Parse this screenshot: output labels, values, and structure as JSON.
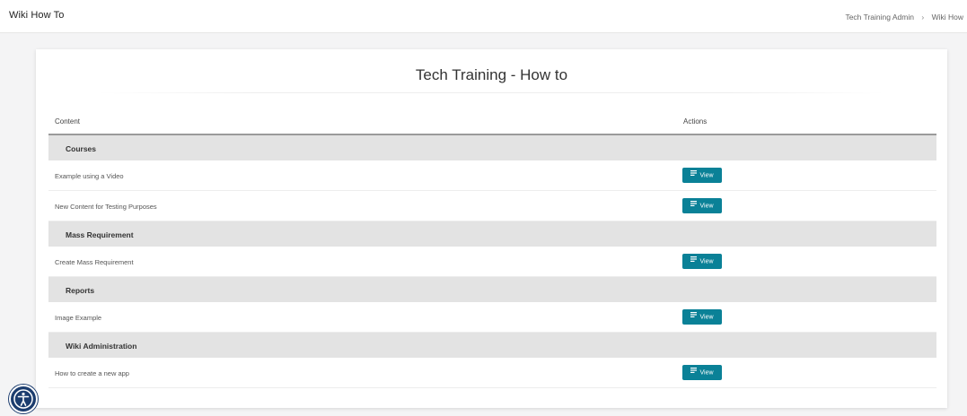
{
  "header": {
    "app_title": "Wiki How To",
    "breadcrumb": [
      "Tech Training Admin",
      "Wiki How"
    ]
  },
  "card": {
    "title": "Tech Training - How to",
    "columns": {
      "content": "Content",
      "actions": "Actions"
    },
    "sections": [
      {
        "name": "Courses",
        "rows": [
          {
            "label": "Example using a Video",
            "action": "View"
          },
          {
            "label": "New Content for Testing Purposes",
            "action": "View"
          }
        ]
      },
      {
        "name": "Mass Requirement",
        "rows": [
          {
            "label": "Create Mass Requirement",
            "action": "View"
          }
        ]
      },
      {
        "name": "Reports",
        "rows": [
          {
            "label": "Image Example",
            "action": "View"
          }
        ]
      },
      {
        "name": "Wiki Administration",
        "rows": [
          {
            "label": "How to create a new app",
            "action": "View"
          }
        ]
      }
    ]
  },
  "icons": {
    "view": "list-view-icon",
    "accessibility": "accessibility-icon",
    "breadcrumb_separator": "chevron-right-icon"
  },
  "colors": {
    "view_button": "#0a8197",
    "section_background": "#e3e3e3",
    "accessibility_button": "#1b3c6e"
  }
}
